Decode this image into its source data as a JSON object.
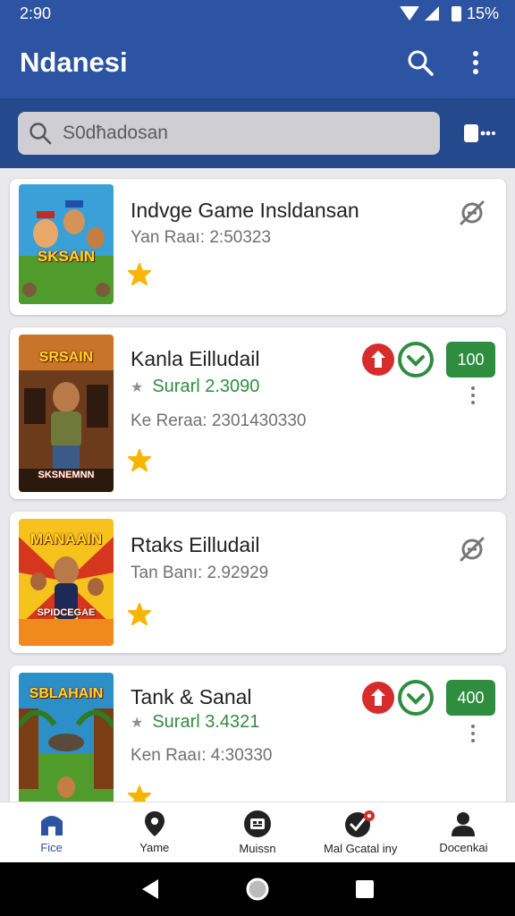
{
  "status": {
    "time": "2:90",
    "battery": "15%"
  },
  "app": {
    "title": "Ndanesi"
  },
  "search": {
    "placeholder": "S0dħadosan"
  },
  "games": [
    {
      "title": "Indvge Game Insldansan",
      "subtitle": "Yan Raaı: 2:50323",
      "thumb_text": "SKSAIN",
      "thumb_colors": [
        "#3aa0d8",
        "#4f9b2c",
        "#b84a10"
      ]
    },
    {
      "title": "Kanla Eilludail",
      "score": "Surarl 2.3090",
      "subtitle": "Ke Reraa: 2301430330",
      "count": "100",
      "thumb_text": "SRSAIN",
      "thumb_bottom_text": "SKSNEMNN",
      "thumb_colors": [
        "#c8742a",
        "#6b3b1c",
        "#2e1a0e"
      ]
    },
    {
      "title": "Rtaks Eilludail",
      "subtitle": "Tan Banı: 2.92929",
      "thumb_text": "MANAAIN",
      "thumb_bottom_text": "SPIDCEGAE",
      "thumb_colors": [
        "#f6c21c",
        "#d7361e",
        "#f08a1c"
      ]
    },
    {
      "title": "Tank & Sanal",
      "score": "Surarl 3.4321",
      "subtitle": "Ken Raaı: 4:30330",
      "count": "400",
      "thumb_text": "SBLAHAIN",
      "thumb_colors": [
        "#2d8fc8",
        "#4f9b2c",
        "#7a3d14"
      ]
    }
  ],
  "bottom_nav": [
    {
      "label": "Fice",
      "icon": "home-icon"
    },
    {
      "label": "Yame",
      "icon": "location-pin-icon"
    },
    {
      "label": "Muissn",
      "icon": "media-icon"
    },
    {
      "label": "Mal Gcatal iny",
      "icon": "check-settings-icon"
    },
    {
      "label": "Docenkai",
      "icon": "person-icon"
    }
  ],
  "colors": {
    "primary": "#2d54a2",
    "search_bar": "#25498d",
    "green": "#2f8d3f",
    "red": "#d62c2c",
    "star": "#f7b500"
  }
}
